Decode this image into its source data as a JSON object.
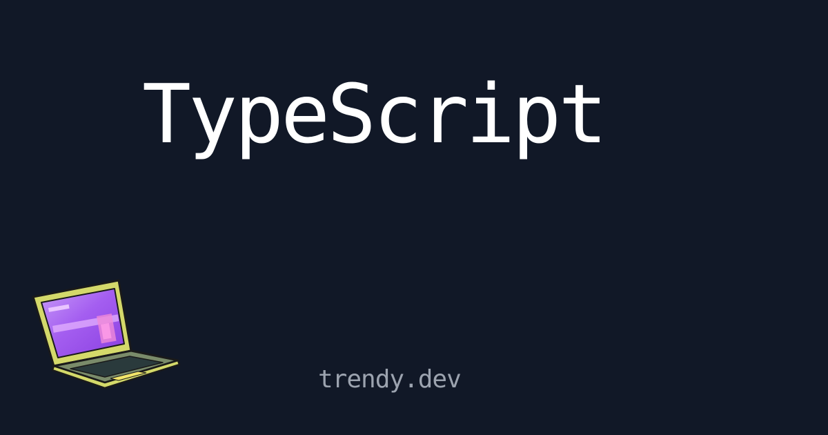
{
  "page": {
    "background": "#111827",
    "title": "TypeScript",
    "title_color": "#ffffff",
    "site_name": "trendy.dev",
    "site_color": "#9ca3af"
  },
  "illustration": {
    "icon": "laptop-icon",
    "colors": {
      "body": "#d4d96a",
      "screen": "#b46ef0",
      "keyboard": "#2a3a3c",
      "outline": "#1a1a1a"
    }
  }
}
